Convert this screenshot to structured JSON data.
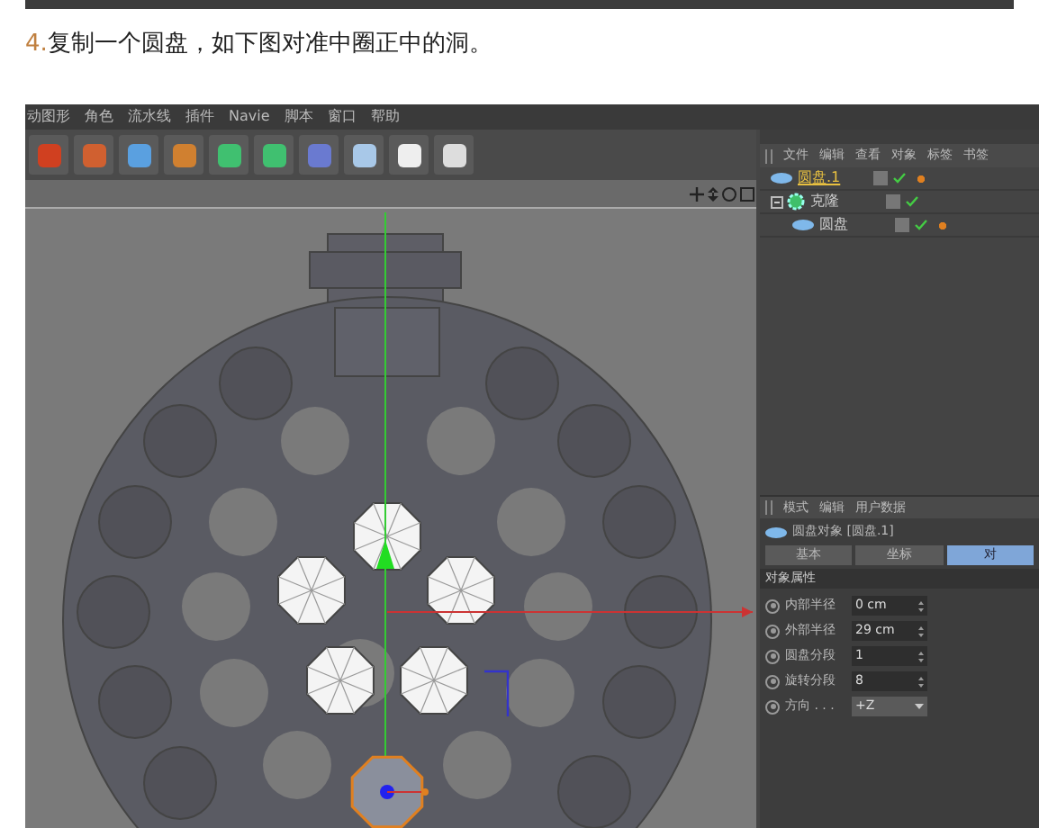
{
  "step_text": {
    "number": "4.",
    "text": "复制一个圆盘，如下图对准中圈正中的洞。"
  },
  "menu": [
    "动图形",
    "角色",
    "流水线",
    "插件",
    "Navie",
    "脚本",
    "窗口",
    "帮助"
  ],
  "object_manager": {
    "menu": [
      "文件",
      "编辑",
      "查看",
      "对象",
      "标签",
      "书签"
    ],
    "objects": [
      {
        "name": "圆盘.1",
        "kind": "disc",
        "selected": true
      },
      {
        "name": "克隆",
        "kind": "cloner",
        "selected": false,
        "expanded": true,
        "children": [
          {
            "name": "圆盘",
            "kind": "disc",
            "selected": false
          }
        ]
      }
    ]
  },
  "attributes": {
    "menu": [
      "模式",
      "编辑",
      "用户数据"
    ],
    "title": "圆盘对象 [圆盘.1]",
    "tabs": [
      {
        "label": "基本",
        "selected": false
      },
      {
        "label": "坐标",
        "selected": false
      },
      {
        "label": "对",
        "selected": true
      }
    ],
    "section": "对象属性",
    "fields": [
      {
        "label": "内部半径",
        "value": "0 cm",
        "kind": "number"
      },
      {
        "label": "外部半径",
        "value": "29 cm",
        "kind": "number"
      },
      {
        "label": "圆盘分段",
        "value": "1",
        "kind": "number"
      },
      {
        "label": "旋转分段",
        "value": "8",
        "kind": "number"
      },
      {
        "label": "方向 . . .",
        "value": "+Z",
        "kind": "dropdown"
      }
    ]
  }
}
